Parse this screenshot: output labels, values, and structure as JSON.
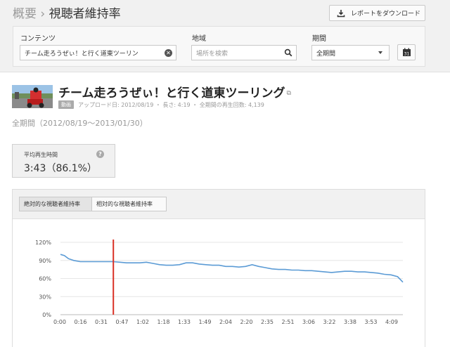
{
  "breadcrumb": {
    "parent": "概要",
    "separator": "›",
    "current": "視聴者維持率"
  },
  "download": {
    "label": "レポートをダウンロード"
  },
  "filters": {
    "content": {
      "label": "コンテンツ",
      "value": "チーム走ろうぜぃ！と行く道東ツーリン"
    },
    "region": {
      "label": "地域",
      "placeholder": "場所を検索"
    },
    "period": {
      "label": "期間",
      "value": "全期間",
      "calendar_text": "31"
    }
  },
  "video": {
    "title": "チーム走ろうぜぃ！と行く道東ツーリング",
    "badge": "動画",
    "meta": "アップロード日: 2012/08/19 ・ 長さ: 4:19 ・ 全期間の再生回数: 4,139",
    "range": "全期間（2012/08/19〜2013/01/30）"
  },
  "stat": {
    "label": "平均再生時間",
    "value": "3:43（86.1%）",
    "help": "?"
  },
  "tabs": [
    {
      "label": "絶対的な視聴者維持率",
      "active": true
    },
    {
      "label": "相対的な視聴者維持率",
      "active": false
    }
  ],
  "colors": {
    "line": "#5b9bd5",
    "marker": "#d93025",
    "grid": "#e6e6e6"
  },
  "chart_data": {
    "type": "line",
    "xlabel": "",
    "ylabel": "",
    "x_ticks": [
      "0:00",
      "0:16",
      "0:31",
      "0:47",
      "1:02",
      "1:18",
      "1:33",
      "1:49",
      "2:04",
      "2:20",
      "2:35",
      "2:51",
      "3:06",
      "3:22",
      "3:38",
      "3:53",
      "4:09"
    ],
    "y_ticks": [
      "0%",
      "30%",
      "60%",
      "90%",
      "120%"
    ],
    "ylim": [
      0,
      120
    ],
    "xlim": [
      0,
      259
    ],
    "grid": true,
    "marker_x": 40,
    "series": [
      {
        "name": "",
        "x": [
          0,
          3,
          6,
          10,
          15,
          20,
          25,
          30,
          35,
          40,
          45,
          50,
          55,
          60,
          65,
          70,
          75,
          80,
          85,
          90,
          95,
          100,
          105,
          110,
          115,
          120,
          125,
          130,
          135,
          140,
          145,
          150,
          155,
          160,
          165,
          170,
          175,
          180,
          185,
          190,
          195,
          200,
          205,
          210,
          215,
          220,
          225,
          230,
          235,
          240,
          245,
          250,
          255,
          259
        ],
        "y": [
          100,
          98,
          93,
          90,
          88,
          88,
          88,
          88,
          88,
          88,
          87,
          86,
          86,
          86,
          87,
          85,
          83,
          82,
          82,
          83,
          86,
          86,
          84,
          83,
          82,
          82,
          80,
          80,
          79,
          80,
          83,
          80,
          78,
          76,
          75,
          75,
          74,
          74,
          73,
          73,
          72,
          71,
          70,
          71,
          72,
          72,
          71,
          71,
          70,
          69,
          67,
          66,
          63,
          54
        ]
      }
    ]
  }
}
